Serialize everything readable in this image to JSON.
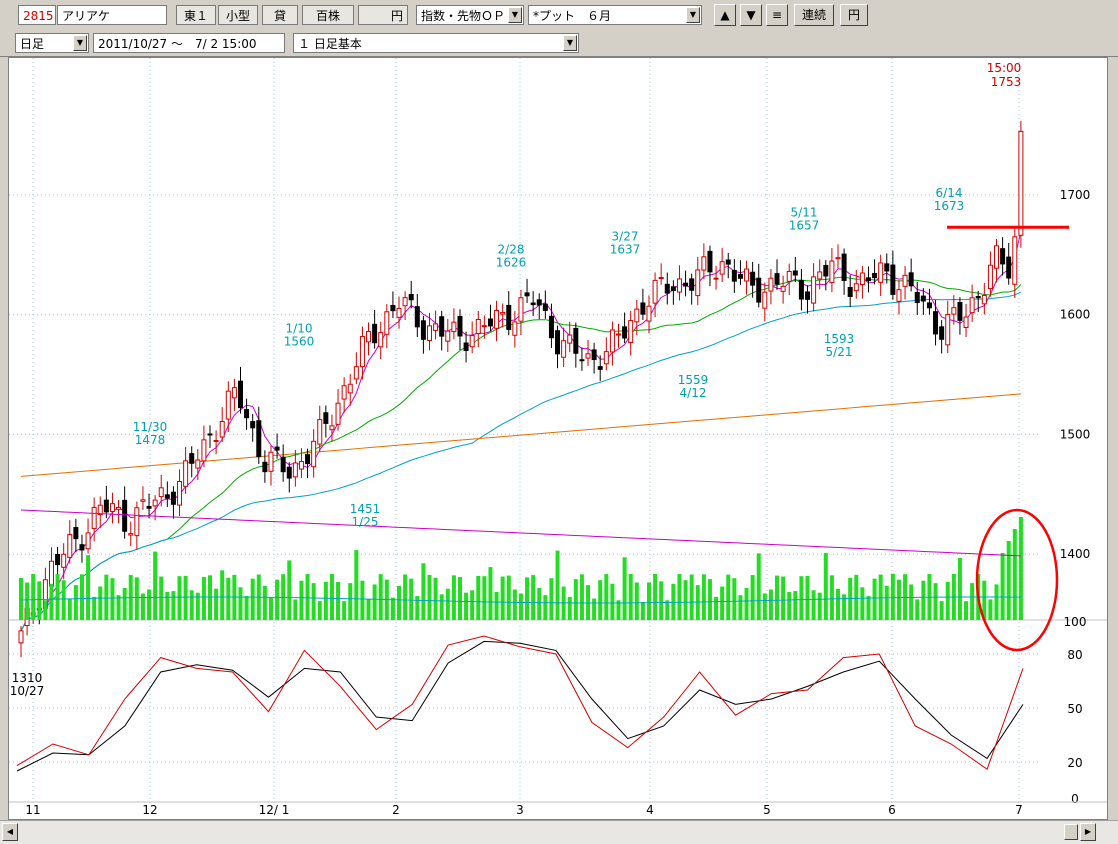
{
  "toolbar": {
    "code": "2815",
    "name": "アリアケ",
    "market": "東１",
    "size": "小型",
    "credit": "貸",
    "unit": "百株",
    "currency_blank": "",
    "currency": "円",
    "index_select": "指数・先物ＯＰ",
    "option_select": "*プット　６月",
    "up_arrow": "▲",
    "down_arrow": "▼",
    "menu": "≡",
    "renzoku": "連続",
    "en_button": "円",
    "period_select": "日足",
    "date_range": "2011/10/27 ～　7/ 2 15:00",
    "template_select": "１ 日足基本"
  },
  "colors": {
    "up": "#d40000",
    "down": "#000000",
    "volume": "#22dd22",
    "ma_short": "#cc00cc",
    "ma_mid": "#00aa00",
    "ma_long": "#00a0c8",
    "ma_xlong": "#e07000",
    "annot": "#00a0b0",
    "latest": "#d40000",
    "stoch_k": "#d40000",
    "stoch_d": "#000000",
    "grid": "#b0c8d8"
  },
  "chart_data": [
    {
      "type": "candlestick",
      "panel": "price",
      "ylim": [
        1300,
        1760
      ],
      "yticks": [
        1400,
        1500,
        1600,
        1700
      ],
      "x_labels": [
        "11",
        "12",
        "12/ 1",
        "2",
        "3",
        "4",
        "5",
        "6",
        "7"
      ],
      "annotations": [
        {
          "label": "1310",
          "sub": "10/27"
        },
        {
          "label": "11/30",
          "sub": "1478"
        },
        {
          "label": "1/10",
          "sub": "1560"
        },
        {
          "label": "1451",
          "sub": "1/25"
        },
        {
          "label": "2/28",
          "sub": "1626"
        },
        {
          "label": "3/27",
          "sub": "1637"
        },
        {
          "label": "1559",
          "sub": "4/12"
        },
        {
          "label": "5/11",
          "sub": "1657"
        },
        {
          "label": "1593",
          "sub": "5/21"
        },
        {
          "label": "6/14",
          "sub": "1673"
        }
      ],
      "latest": {
        "time": "15:00",
        "price": "1753"
      },
      "ohlc_anchor_closes": [
        1330,
        1385,
        1410,
        1440,
        1428,
        1445,
        1462,
        1500,
        1535,
        1478,
        1470,
        1495,
        1540,
        1585,
        1610,
        1590,
        1582,
        1588,
        1600,
        1612,
        1575,
        1562,
        1575,
        1610,
        1625,
        1630,
        1645,
        1620,
        1628,
        1622,
        1640,
        1625,
        1636,
        1618,
        1590,
        1600,
        1645,
        1630
      ]
    },
    {
      "type": "bar",
      "panel": "volume",
      "ylabel_tick": "100"
    },
    {
      "type": "line",
      "panel": "stochastic",
      "ylim": [
        0,
        90
      ],
      "yticks": [
        0,
        20,
        50,
        80
      ],
      "k": [
        18,
        30,
        24,
        55,
        78,
        72,
        70,
        48,
        82,
        62,
        38,
        52,
        85,
        90,
        84,
        80,
        42,
        28,
        45,
        70,
        46,
        58,
        60,
        78,
        80,
        40,
        30,
        16,
        72
      ],
      "d": [
        15,
        25,
        24,
        40,
        70,
        74,
        71,
        56,
        72,
        70,
        45,
        43,
        75,
        87,
        86,
        82,
        55,
        33,
        40,
        60,
        52,
        55,
        62,
        70,
        76,
        55,
        35,
        22,
        52
      ]
    }
  ]
}
